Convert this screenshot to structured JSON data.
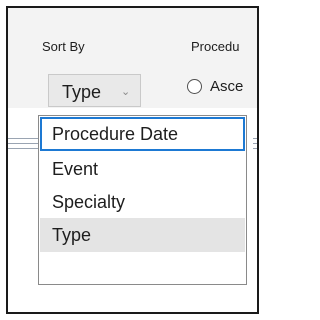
{
  "sort_by": {
    "label": "Sort By",
    "selected_value": "Type",
    "options": [
      "Procedure Date",
      "Event",
      "Specialty",
      "Type"
    ]
  },
  "procedure": {
    "label": "Procedu",
    "radio_label": "Asce"
  },
  "colors": {
    "focus_border": "#1d79d3",
    "selected_background": "#e4e4e4"
  }
}
